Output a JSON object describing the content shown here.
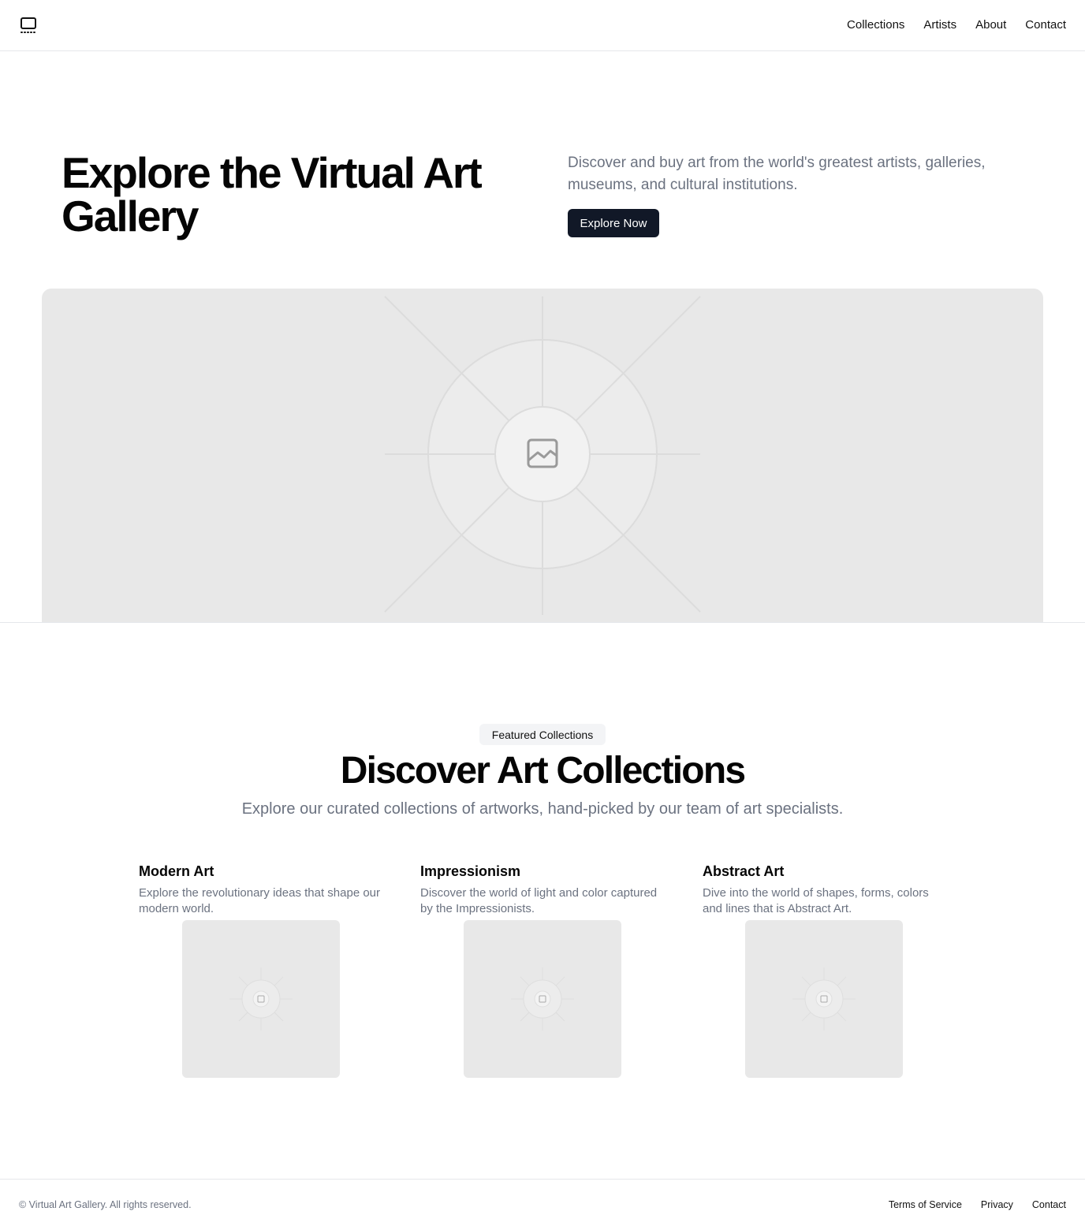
{
  "header": {
    "logo_icon": "gallery-icon",
    "nav": [
      "Collections",
      "Artists",
      "About",
      "Contact"
    ]
  },
  "hero": {
    "title": "Explore the Virtual Art Gallery",
    "description": "Discover and buy art from the world's greatest artists, galleries, museums, and cultural institutions.",
    "button_label": "Explore Now",
    "image_icon": "image-placeholder-icon"
  },
  "featured": {
    "badge": "Featured Collections",
    "title": "Discover Art Collections",
    "subtitle": "Explore our curated collections of artworks, hand-picked by our team of art specialists.",
    "cards": [
      {
        "title": "Modern Art",
        "description": "Explore the revolutionary ideas that shape our modern world."
      },
      {
        "title": "Impressionism",
        "description": "Discover the world of light and color captured by the Impressionists."
      },
      {
        "title": "Abstract Art",
        "description": "Dive into the world of shapes, forms, colors and lines that is Abstract Art."
      }
    ]
  },
  "footer": {
    "copyright": "© Virtual Art Gallery. All rights reserved.",
    "links": [
      "Terms of Service",
      "Privacy",
      "Contact"
    ]
  },
  "colors": {
    "primary_button": "#111827",
    "muted_text": "#6b7280",
    "placeholder_bg": "#e8e8e8"
  }
}
